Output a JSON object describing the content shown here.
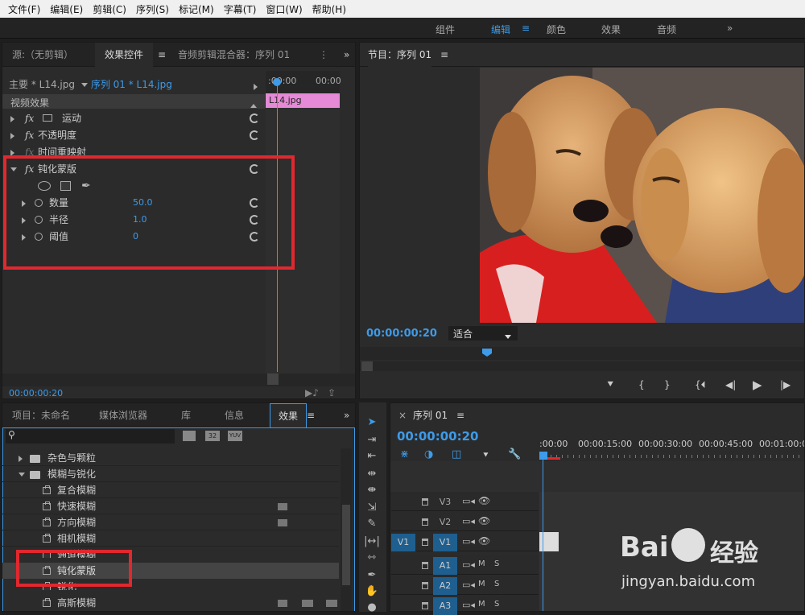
{
  "menu": [
    "文件(F)",
    "编辑(E)",
    "剪辑(C)",
    "序列(S)",
    "标记(M)",
    "字幕(T)",
    "窗口(W)",
    "帮助(H)"
  ],
  "workspaces": {
    "items": [
      "组件",
      "编辑",
      "颜色",
      "效果",
      "音频"
    ],
    "active": "编辑",
    "more": "»"
  },
  "effect_controls": {
    "tabs": [
      "源:（无剪辑）",
      "效果控件",
      "音频剪辑混合器：序列 01"
    ],
    "master": "主要 * L14.jpg",
    "sequence": "序列 01 * L14.jpg",
    "ruler": [
      ":00:00",
      "00:00"
    ],
    "clip": "L14.jpg",
    "section": "视频效果",
    "effects": [
      "运动",
      "不透明度",
      "时间重映射",
      "钝化蒙版"
    ],
    "params": [
      {
        "name": "数量",
        "value": "50.0"
      },
      {
        "name": "半径",
        "value": "1.0"
      },
      {
        "name": "阈值",
        "value": "0"
      }
    ],
    "timecode": "00:00:00:20"
  },
  "program": {
    "title": "节目：序列 01",
    "timecode": "00:00:00:20",
    "fit": "适合"
  },
  "project": {
    "tabs": [
      "项目：未命名",
      "媒体浏览器",
      "库",
      "信息",
      "效果"
    ],
    "badges": [
      "32",
      "YUV"
    ],
    "folders": [
      "杂色与颗粒",
      "模糊与锐化"
    ],
    "items": [
      "复合模糊",
      "快速模糊",
      "方向模糊",
      "相机模糊",
      "通道模糊",
      "钝化蒙版",
      "锐化",
      "高斯模糊"
    ]
  },
  "timeline": {
    "title": "序列 01",
    "timecode": "00:00:00:20",
    "ruler": [
      ":00:00",
      "00:00:15:00",
      "00:00:30:00",
      "00:00:45:00",
      "00:01:00:00"
    ],
    "video_tracks": [
      "V3",
      "V2",
      "V1"
    ],
    "audio_tracks": [
      "A1",
      "A2",
      "A3"
    ],
    "source_patch": "V1",
    "m": "M",
    "s": "S"
  },
  "watermark": {
    "brand": "Bai",
    "brand2": "经验",
    "url": "jingyan.baidu.com"
  },
  "colors": {
    "accent": "#3d9be9",
    "clip": "#e58ad6",
    "highlight": "#e0282e"
  }
}
